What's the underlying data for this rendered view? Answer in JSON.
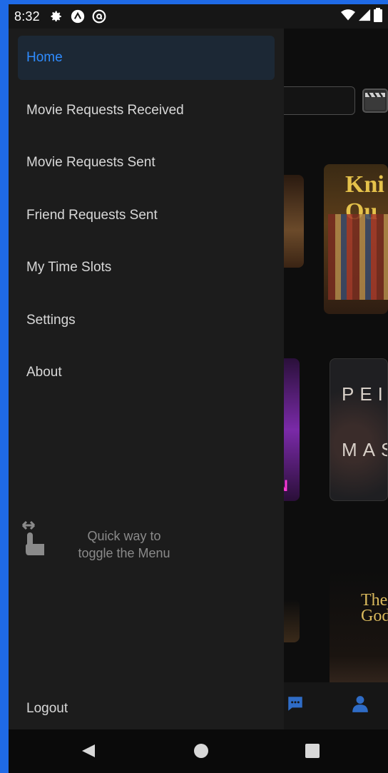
{
  "status_bar": {
    "time": "8:32",
    "icons": [
      "gear-icon",
      "app-a-icon",
      "at-icon"
    ],
    "right_icons": [
      "wifi-icon",
      "signal-icon",
      "battery-icon"
    ]
  },
  "drawer": {
    "items": [
      {
        "label": "Home",
        "active": true
      },
      {
        "label": "Movie Requests Received",
        "active": false
      },
      {
        "label": "Movie Requests Sent",
        "active": false
      },
      {
        "label": "Friend Requests Sent",
        "active": false
      },
      {
        "label": "My Time Slots",
        "active": false
      },
      {
        "label": "Settings",
        "active": false
      },
      {
        "label": "About",
        "active": false
      }
    ],
    "hint": {
      "line1": "Quick way to",
      "line2": "toggle the Menu"
    },
    "logout_label": "Logout"
  },
  "background": {
    "posters": [
      {
        "text": "Kni Ou"
      },
      {
        "text1": "PEI",
        "text2": "MAS"
      },
      {
        "text": "The Godf"
      },
      {
        "text": "N"
      }
    ]
  },
  "colors": {
    "accent": "#2f8cff",
    "drawer_bg": "#1c1c1c",
    "active_bg": "#1c2835",
    "frame": "#1f6ae6"
  }
}
